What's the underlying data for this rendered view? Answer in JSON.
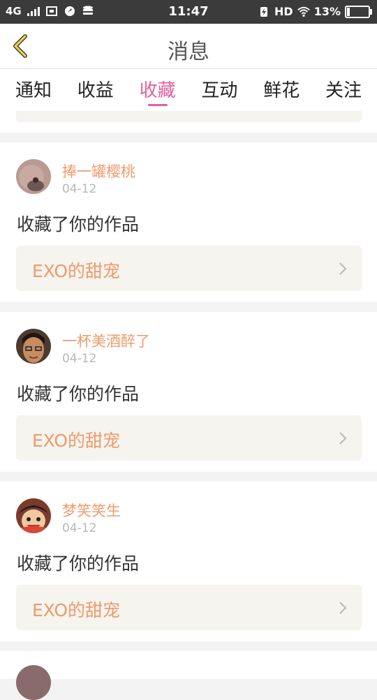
{
  "status_bar": {
    "network": "4G",
    "time": "11:47",
    "hd": "HD",
    "battery_percent": "13%",
    "battery_level": 0.13
  },
  "header": {
    "title": "消息",
    "back_icon": "chevron-left-icon"
  },
  "tabs": [
    {
      "label": "通知",
      "active": false
    },
    {
      "label": "收益",
      "active": false
    },
    {
      "label": "收藏",
      "active": true
    },
    {
      "label": "互动",
      "active": false
    },
    {
      "label": "鲜花",
      "active": false
    },
    {
      "label": "关注",
      "active": false
    }
  ],
  "colors": {
    "accent": "#e4609c",
    "name": "#f09a6c",
    "card_bg": "#f5f4ee"
  },
  "items": [
    {
      "user": "捧一罐樱桃",
      "date": "04-12",
      "action": "收藏了你的作品",
      "work": "EXO的甜宠"
    },
    {
      "user": "一杯美酒醉了",
      "date": "04-12",
      "action": "收藏了你的作品",
      "work": "EXO的甜宠"
    },
    {
      "user": "梦笑笑生",
      "date": "04-12",
      "action": "收藏了你的作品",
      "work": "EXO的甜宠"
    }
  ]
}
